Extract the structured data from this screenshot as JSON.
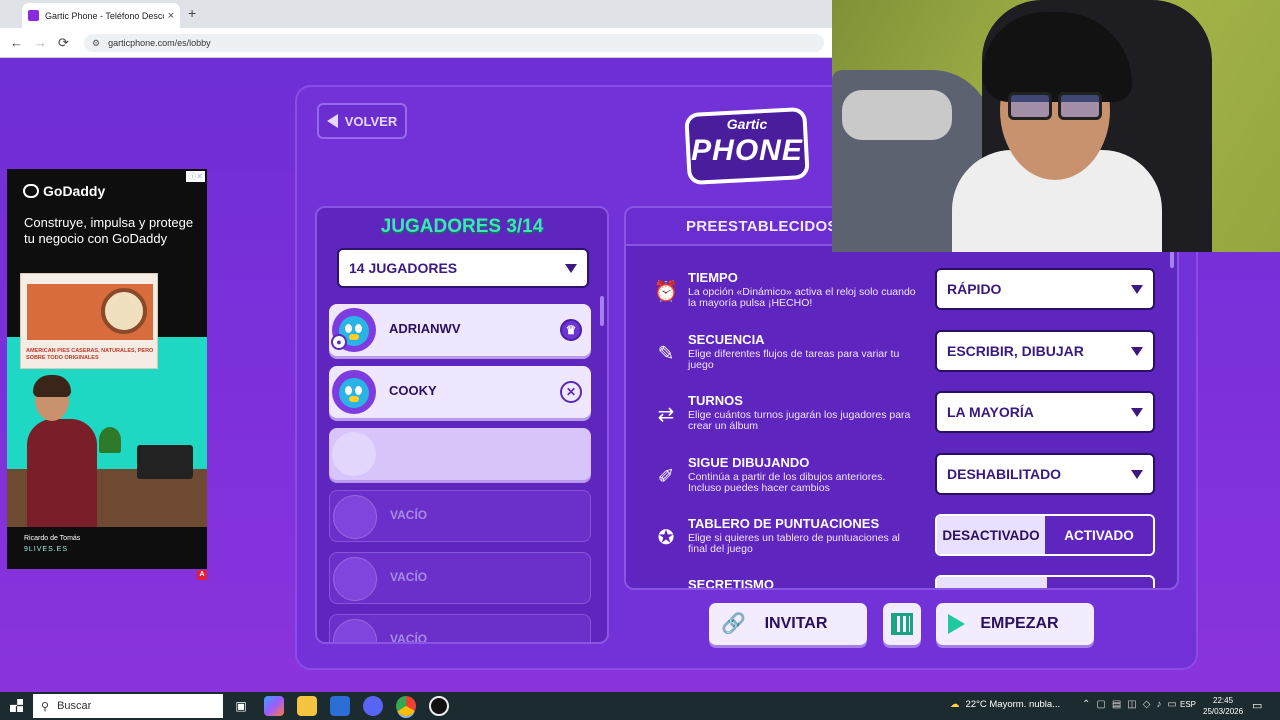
{
  "browser": {
    "tab_title": "Gartic Phone - Teléfono Descon",
    "tab_close": "×",
    "new_tab": "+",
    "url": "garticphone.com/es/lobby",
    "back": "←",
    "forward": "→",
    "reload": "⟳"
  },
  "ad": {
    "brand": "GoDaddy",
    "headline": "Construye, impulsa y protege tu negocio con GoDaddy",
    "card_text": "AMERICAN PIES CASERAS, NATURALES, PERO SOBRE TODO ORIGINALES",
    "person": "Ricardo de Tomás",
    "site": "9LIVES.ES",
    "badge": "A"
  },
  "game": {
    "back_label": "VOLVER",
    "logo_top": "Gartic",
    "logo_main": "PHONE",
    "players": {
      "title": "JUGADORES 3/14",
      "count_select": "14 JUGADORES",
      "list": [
        {
          "name": "ADRIANWV",
          "state": "filled",
          "action_icon": "crown-icon"
        },
        {
          "name": "COOKY",
          "state": "filled",
          "action_icon": "kick-icon"
        },
        {
          "name": "",
          "state": "loading"
        },
        {
          "name": "VACÍO",
          "state": "empty"
        },
        {
          "name": "VACÍO",
          "state": "empty"
        },
        {
          "name": "VACÍO",
          "state": "empty"
        }
      ]
    },
    "settings": {
      "title": "PREESTABLECIDOS",
      "items": [
        {
          "name": "TIEMPO",
          "desc": "La opción «Dinámico» activa el reloj solo cuando la mayoría pulsa ¡HECHO!",
          "value": "RÁPIDO",
          "icon": "clock-icon"
        },
        {
          "name": "SECUENCIA",
          "desc": "Elige diferentes flujos de tareas para variar tu juego",
          "value": "ESCRIBIR, DIBUJAR",
          "icon": "sequence-icon"
        },
        {
          "name": "TURNOS",
          "desc": "Elige cuántos turnos jugarán los jugadores para crear un álbum",
          "value": "LA MAYORÍA",
          "icon": "turns-icon"
        },
        {
          "name": "SIGUE DIBUJANDO",
          "desc": "Continúa a partir de los dibujos anteriores. Incluso puedes hacer cambios",
          "value": "DESHABILITADO",
          "icon": "keep-drawing-icon"
        },
        {
          "name": "TABLERO DE PUNTUACIONES",
          "desc": "Elige si quieres un tablero de puntuaciones al final del juego",
          "toggle_off": "DESACTIVADO",
          "toggle_on": "ACTIVADO",
          "icon": "scoreboard-icon"
        },
        {
          "name": "SECRETISMO",
          "icon": "secrecy-icon"
        }
      ]
    },
    "actions": {
      "invite": "INVITAR",
      "start": "EMPEZAR"
    }
  },
  "taskbar": {
    "search_placeholder": "Buscar",
    "weather": "22°C  Mayorm. nubla...",
    "language": "ESP",
    "time": "22:45",
    "date": "25/03/2026"
  },
  "colors": {
    "page_bg": "#7a2fd9",
    "panel_bg": "#5f25bf",
    "accent_teal": "#3ce6b8",
    "select_text": "#3a1a80"
  }
}
